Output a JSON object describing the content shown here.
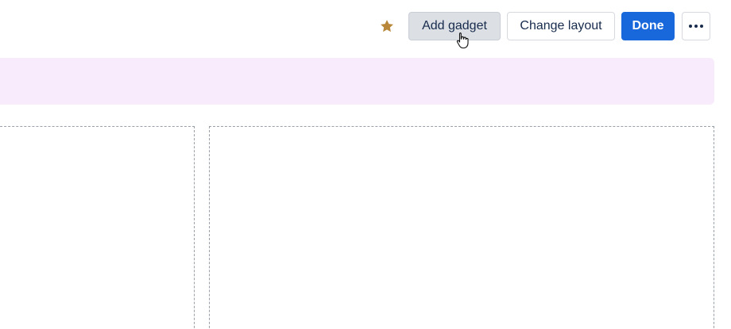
{
  "toolbar": {
    "star_icon": "star-icon",
    "star_color": "#b8873a",
    "add_gadget_label": "Add gadget",
    "change_layout_label": "Change layout",
    "done_label": "Done",
    "more_icon": "more-horizontal-icon"
  },
  "banner": {
    "background": "#f8ebfb"
  },
  "colors": {
    "primary": "#1868db",
    "text": "#172b4d"
  }
}
